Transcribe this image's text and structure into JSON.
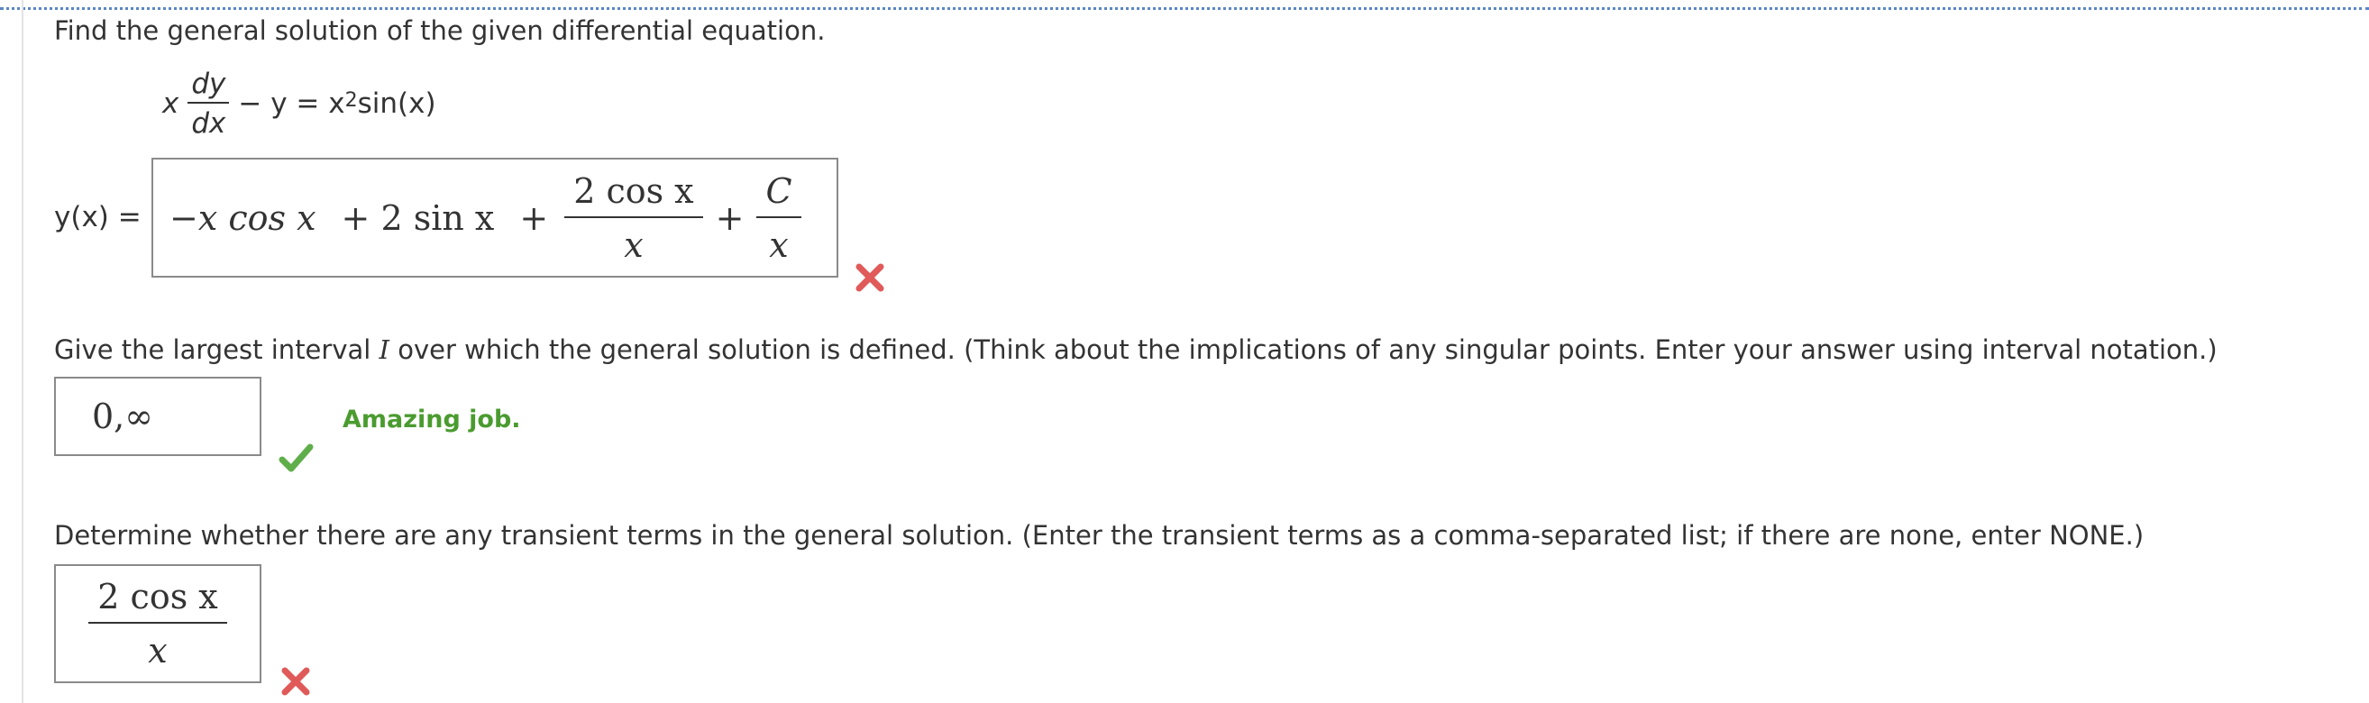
{
  "question": {
    "intro": "Find the general solution of the given differential equation.",
    "equation": {
      "x_coef": "x",
      "dy": "dy",
      "dx": "dx",
      "rest": "− y = x",
      "power": "2",
      "tail": " sin(x)"
    }
  },
  "part1": {
    "label": "y(x) =",
    "answer": {
      "term1": "−x cos  x",
      "term2": "+ 2 sin  x",
      "plus1": "+",
      "frac1_num": "2 cos  x",
      "frac1_den": "x",
      "plus2": "+",
      "frac2_num": "C",
      "frac2_den": "x"
    },
    "status": "incorrect"
  },
  "part2": {
    "prompt_before": "Give the largest interval ",
    "prompt_var": "I",
    "prompt_after": " over which the general solution is defined. (Think about the implications of any singular points. Enter your answer using interval notation.)",
    "answer": "0,∞",
    "status": "correct",
    "feedback": "Amazing job."
  },
  "part3": {
    "prompt": "Determine whether there are any transient terms in the general solution. (Enter the transient terms as a comma-separated list; if there are none, enter NONE.)",
    "answer": {
      "num": "2 cos  x",
      "den": "x"
    },
    "status": "incorrect"
  },
  "colors": {
    "correct": "#5fae4a",
    "incorrect": "#e05a5a",
    "feedback_text": "#4a9b2f",
    "top_border": "#5a86c6"
  },
  "icons": {
    "correct": "check-icon",
    "incorrect": "x-icon"
  }
}
